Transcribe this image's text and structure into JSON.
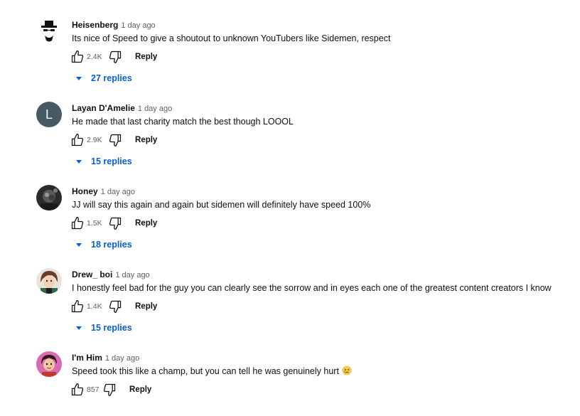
{
  "comments": [
    {
      "author": "Heisenberg",
      "time": "1 day ago",
      "text": "Its nice of Speed to give a shoutout to unknown YouTubers like Sidemen, respect",
      "likes": "2.4K",
      "reply_label": "Reply",
      "replies": "27 replies",
      "avatar": "heisenberg-avatar"
    },
    {
      "author": "Layan D'Amelie",
      "time": "1 day ago",
      "text": "He made that last charity match the best though LOOOL",
      "likes": "2.9K",
      "reply_label": "Reply",
      "replies": "15 replies",
      "avatar_letter": "L",
      "avatar_color": "#455a64"
    },
    {
      "author": "Honey",
      "time": "1 day ago",
      "text": "JJ will say this again and again but sidemen will definitely have speed 100%",
      "likes": "1.5K",
      "reply_label": "Reply",
      "replies": "18 replies",
      "avatar": "photo-avatar"
    },
    {
      "author": "Drew_ boi",
      "time": "1 day ago",
      "text": "I honestly feel bad for the guy you can clearly see the sorrow and in eyes each one of the greatest content creators I know",
      "likes": "1.4K",
      "reply_label": "Reply",
      "replies": "15 replies",
      "avatar": "anime-avatar"
    },
    {
      "author": "I'm Him",
      "time": "1 day ago",
      "text": "Speed took this like a champ, but you can tell he was genuinely hurt",
      "emoji": "sad-face-emoji",
      "likes": "857",
      "reply_label": "Reply",
      "avatar": "cartoon-avatar"
    }
  ],
  "colors": {
    "link_blue": "#065fd4",
    "secondary_text": "#606060"
  }
}
